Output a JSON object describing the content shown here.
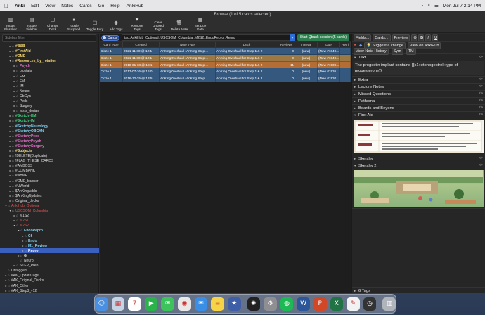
{
  "menubar": {
    "apple": "",
    "app": "Anki",
    "items": [
      "Edit",
      "View",
      "Notes",
      "Cards",
      "Go",
      "Help",
      "AnkiHub"
    ],
    "datetime": "Mon Jul 7 2:14 PM"
  },
  "window": {
    "title": "Browse (1 of 5 cards selected)"
  },
  "toolbar": {
    "items": [
      {
        "label": "Toggle Flashbar",
        "icon": "toggle-flashbar-icon",
        "glyph": "▥"
      },
      {
        "label": "Toggle Sidebar",
        "icon": "toggle-sidebar-icon",
        "glyph": "▤"
      },
      {
        "label": "Change Deck",
        "icon": "change-deck-icon",
        "glyph": "▢"
      },
      {
        "label": "Toggle Suspend",
        "icon": "pause-icon",
        "glyph": "⏸"
      },
      {
        "label": "Toggle Bury",
        "icon": "bury-icon",
        "glyph": "☐"
      },
      {
        "label": "Add Tags",
        "icon": "tag-add-icon",
        "glyph": "✚"
      },
      {
        "label": "Remove Tags",
        "icon": "tag-remove-icon",
        "glyph": "✖"
      },
      {
        "label": "Clear Unused Tags",
        "icon": "clear-tags-icon",
        "glyph": "✧"
      },
      {
        "label": "Delete Note",
        "icon": "trash-icon",
        "glyph": "🗑"
      },
      {
        "label": "Set Due Date",
        "icon": "calendar-icon",
        "glyph": "▦"
      }
    ]
  },
  "sidebar": {
    "filter_placeholder": "Sidebar filter",
    "items": [
      {
        "label": "#B&B",
        "indent": 2,
        "color": "#f5d76e",
        "bold": true,
        "arrow": "▸"
      },
      {
        "label": "#FirstAid",
        "indent": 2,
        "color": "#f5d76e",
        "bold": true,
        "arrow": "▸"
      },
      {
        "label": "#OME",
        "indent": 2,
        "color": "#f5d76e",
        "bold": true,
        "arrow": "▸"
      },
      {
        "label": "#Resources_by_rotation",
        "indent": 2,
        "color": "#f5d76e",
        "bold": true,
        "arrow": "▾"
      },
      {
        "label": "Psych",
        "indent": 3,
        "color": "#e070c8",
        "bold": true,
        "arrow": "▸"
      },
      {
        "label": "biostats",
        "indent": 3,
        "color": "#dddddd",
        "bold": false,
        "arrow": "▸"
      },
      {
        "label": "EM",
        "indent": 3,
        "color": "#dddddd",
        "bold": false,
        "arrow": "▸"
      },
      {
        "label": "FM",
        "indent": 3,
        "color": "#dddddd",
        "bold": false,
        "arrow": "▸"
      },
      {
        "label": "IM",
        "indent": 3,
        "color": "#dddddd",
        "bold": false,
        "arrow": "▸"
      },
      {
        "label": "Neuro",
        "indent": 3,
        "color": "#dddddd",
        "bold": false,
        "arrow": "▸"
      },
      {
        "label": "ObGyn",
        "indent": 3,
        "color": "#dddddd",
        "bold": false,
        "arrow": "▸"
      },
      {
        "label": "Peds",
        "indent": 3,
        "color": "#dddddd",
        "bold": false,
        "arrow": "▸"
      },
      {
        "label": "Surgery",
        "indent": 3,
        "color": "#dddddd",
        "bold": false,
        "arrow": "▸"
      },
      {
        "label": "tests_dorian",
        "indent": 3,
        "color": "#dddddd",
        "bold": false,
        "arrow": "▸"
      },
      {
        "label": "#SketchyEM",
        "indent": 2,
        "color": "#3ccf7a",
        "bold": true,
        "arrow": "▸"
      },
      {
        "label": "#SketchyIM",
        "indent": 2,
        "color": "#3ccf7a",
        "bold": true,
        "arrow": "▸"
      },
      {
        "label": "#SketchyNeurology",
        "indent": 2,
        "color": "#7fd1f0",
        "bold": true,
        "arrow": "▸"
      },
      {
        "label": "#SketchyOBGYN",
        "indent": 2,
        "color": "#7fd1f0",
        "bold": true,
        "arrow": "▸"
      },
      {
        "label": "#SketchyPeds",
        "indent": 2,
        "color": "#e070c8",
        "bold": true,
        "arrow": "▸"
      },
      {
        "label": "#SketchyPsych",
        "indent": 2,
        "color": "#e070c8",
        "bold": true,
        "arrow": "▸"
      },
      {
        "label": "#SketchySurgery",
        "indent": 2,
        "color": "#e070c8",
        "bold": true,
        "arrow": "▸"
      },
      {
        "label": "#Subjects",
        "indent": 2,
        "color": "#f5d76e",
        "bold": true,
        "arrow": "▸"
      },
      {
        "label": "!DELETE(Duplicate)",
        "indent": 2,
        "color": "#dddddd",
        "bold": false,
        "arrow": "▸"
      },
      {
        "label": "!FLAG_THESE_CARDS",
        "indent": 2,
        "color": "#dddddd",
        "bold": false,
        "arrow": "▸"
      },
      {
        "label": "#AMBOSS",
        "indent": 2,
        "color": "#dddddd",
        "bold": false,
        "arrow": "▸"
      },
      {
        "label": "#COMBANK",
        "indent": 2,
        "color": "#dddddd",
        "bold": false,
        "arrow": "▸"
      },
      {
        "label": "#NBME",
        "indent": 2,
        "color": "#dddddd",
        "bold": false,
        "arrow": "▸"
      },
      {
        "label": "#OME_banner",
        "indent": 2,
        "color": "#dddddd",
        "bold": false,
        "arrow": "▸"
      },
      {
        "label": "#UWorld",
        "indent": 2,
        "color": "#dddddd",
        "bold": false,
        "arrow": "▸"
      },
      {
        "label": "$AnKingAdds",
        "indent": 2,
        "color": "#dddddd",
        "bold": false,
        "arrow": "▸"
      },
      {
        "label": "$AnKingUpdates",
        "indent": 2,
        "color": "#dddddd",
        "bold": false,
        "arrow": "▸"
      },
      {
        "label": "Original_decks",
        "indent": 2,
        "color": "#dddddd",
        "bold": false,
        "arrow": "▸"
      },
      {
        "label": "AnkiHub_Optional",
        "indent": 1,
        "color": "#e05555",
        "bold": false,
        "arrow": "▾"
      },
      {
        "label": "USCSOM_Columbia",
        "indent": 2,
        "color": "#e05555",
        "bold": false,
        "arrow": "▾"
      },
      {
        "label": "M1S2",
        "indent": 3,
        "color": "#dddddd",
        "bold": false,
        "arrow": "▸"
      },
      {
        "label": "M2S1",
        "indent": 3,
        "color": "#e05555",
        "bold": false,
        "arrow": "▸"
      },
      {
        "label": "M2S2",
        "indent": 3,
        "color": "#e05555",
        "bold": false,
        "arrow": "▾"
      },
      {
        "label": "EndoRepro",
        "indent": 4,
        "color": "#7fd1f0",
        "bold": true,
        "arrow": "▾"
      },
      {
        "label": "Cf",
        "indent": 5,
        "color": "#7fd1f0",
        "bold": true,
        "arrow": "▸"
      },
      {
        "label": "Endo",
        "indent": 5,
        "color": "#7fd1f0",
        "bold": true,
        "arrow": "▸"
      },
      {
        "label": "M1_Review",
        "indent": 5,
        "color": "#7fd1f0",
        "bold": true,
        "arrow": "▸"
      },
      {
        "label": "Repro",
        "indent": 5,
        "color": "#ffffff",
        "bold": true,
        "arrow": "▸",
        "selected": true
      },
      {
        "label": "GI",
        "indent": 4,
        "color": "#dddddd",
        "bold": true,
        "arrow": "▸"
      },
      {
        "label": "Neuro",
        "indent": 4,
        "color": "#dddddd",
        "bold": false,
        "arrow": ""
      },
      {
        "label": "STEP_Prep",
        "indent": 3,
        "color": "#dddddd",
        "bold": false,
        "arrow": "▸"
      },
      {
        "label": "Untagged",
        "indent": 1,
        "color": "#dddddd",
        "bold": false,
        "arrow": ""
      },
      {
        "label": "#AK_UpdateTags",
        "indent": 1,
        "color": "#dddddd",
        "bold": false,
        "arrow": "▸"
      },
      {
        "label": "#AK_Original_Decks",
        "indent": 1,
        "color": "#dddddd",
        "bold": false,
        "arrow": "▸"
      },
      {
        "label": "#AK_Other",
        "indent": 1,
        "color": "#dddddd",
        "bold": false,
        "arrow": "▸"
      },
      {
        "label": "#AK_Step3_v12",
        "indent": 1,
        "color": "#dddddd",
        "bold": false,
        "arrow": "▸"
      },
      {
        "label": "#PANCE",
        "indent": 1,
        "color": "#dddddd",
        "bold": false,
        "arrow": "▸"
      },
      {
        "label": "%AnKingNoteTypes",
        "indent": 1,
        "color": "#dddddd",
        "bold": false,
        "arrow": ""
      }
    ]
  },
  "main": {
    "mode_label": "Cards",
    "search_value": "tag:AnkiHub_Optional::USCSOM_Columbia::M2S2::EndoRepro::Repro",
    "qbank_button": "Start Qbank session (5 cards)",
    "columns": [
      "Card Type",
      "Created",
      "Note Type",
      "Deck",
      "Reviews",
      "Interval",
      "Due",
      "Retri"
    ],
    "rows": [
      {
        "cells": [
          "Cloze 1",
          "2021-11-30 @ 12:1",
          "AnKingOverhaul (AnKing Step ...",
          "AnKing Overhaul for Step 1 & 2",
          "0",
          "(new)",
          "(New #1849...",
          ""
        ],
        "bg": "#35597e"
      },
      {
        "cells": [
          "Cloze 1",
          "2021-11-30 @ 12:1",
          "AnKingOverhaul (AnKing Step ...",
          "AnKing Overhaul for Step 1 & 2",
          "0",
          "(new)",
          "(New #1849...",
          ""
        ],
        "bg": "#9b7844"
      },
      {
        "cells": [
          "Cloze 1",
          "2018-01-18 @ 18:1",
          "AnKingOverhaul (AnKing Step ...",
          "AnKing Overhaul for Step 1 & 2",
          "11",
          "(new)",
          "(New #1939...",
          ""
        ],
        "bg": "#b46e35"
      },
      {
        "cells": [
          "Cloze 1",
          "2017-07-16 @ 16:0",
          "AnKingOverhaul (AnKing Step ...",
          "AnKing Overhaul for Step 1 & 2",
          "0",
          "(new)",
          "(New #1936...",
          ""
        ],
        "bg": "#35597e"
      },
      {
        "cells": [
          "Cloze 1",
          "2016-12-25 @ 13:5",
          "AnKingOverhaul (AnKing Step ...",
          "AnKing Overhaul for Step 1 & 2",
          "0",
          "(new)",
          "(New #1930...",
          ""
        ],
        "bg": "#35597e"
      }
    ]
  },
  "editor": {
    "buttons": [
      "Fields...",
      "Cards...",
      "Preview"
    ],
    "suggest": "Suggest a change",
    "view_hub": "View on AnkiHub",
    "history": "View Note History",
    "sym": "Sym",
    "tm": "TM",
    "text_label": "Text",
    "text_value": "The progestin implant contains {{c1::etonogestrel::type of progesterone}}",
    "fields": [
      "Extra",
      "Lecture Notes",
      "Missed Questions",
      "Pathoma",
      "Boards and Beyond",
      "First Aid",
      "Sketchy",
      "Sketchy 2"
    ],
    "tags_count": "6 Tags"
  },
  "dock": [
    {
      "name": "finder-icon",
      "bg": "#4a90e2",
      "glyph": "☺"
    },
    {
      "name": "launchpad-icon",
      "bg": "#c7d4e6",
      "glyph": "▦"
    },
    {
      "name": "calendar-icon",
      "bg": "#ffffff",
      "glyph": "7"
    },
    {
      "name": "facetime-icon",
      "bg": "#2ab34b",
      "glyph": "▶"
    },
    {
      "name": "messages-icon",
      "bg": "#3cc35b",
      "glyph": "✉"
    },
    {
      "name": "chrome-icon",
      "bg": "#e8e8e8",
      "glyph": "◉"
    },
    {
      "name": "mail-icon",
      "bg": "#3a8ee6",
      "glyph": "✉"
    },
    {
      "name": "notes-icon",
      "bg": "#f5d547",
      "glyph": "≡"
    },
    {
      "name": "anki-icon",
      "bg": "#3e5fa8",
      "glyph": "★"
    },
    {
      "name": "chatgpt-icon",
      "bg": "#222222",
      "glyph": "✺"
    },
    {
      "name": "settings-icon",
      "bg": "#8e8e93",
      "glyph": "⚙"
    },
    {
      "name": "spotify-icon",
      "bg": "#1db954",
      "glyph": "◍"
    },
    {
      "name": "word-icon",
      "bg": "#2b579a",
      "glyph": "W"
    },
    {
      "name": "powerpoint-icon",
      "bg": "#d24726",
      "glyph": "P"
    },
    {
      "name": "excel-icon",
      "bg": "#217346",
      "glyph": "X"
    },
    {
      "name": "texteditor-icon",
      "bg": "#f2f2f2",
      "glyph": "✎"
    },
    {
      "name": "clock-icon",
      "bg": "#333333",
      "glyph": "◷"
    },
    {
      "name": "trash-icon",
      "bg": "#b0b4bb",
      "glyph": "▥"
    }
  ]
}
